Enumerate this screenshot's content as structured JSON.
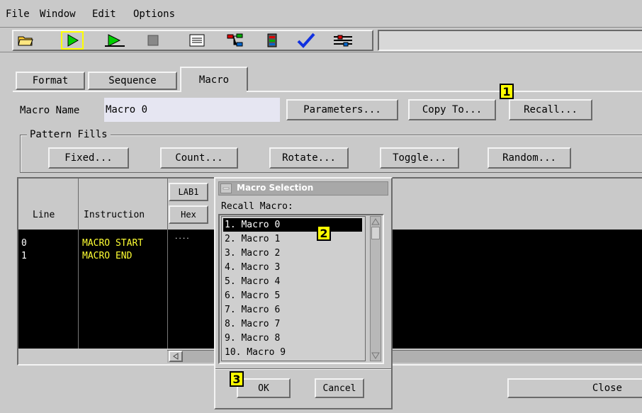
{
  "menubar": {
    "items": [
      "File",
      "Window",
      "Edit",
      "Options"
    ]
  },
  "tabs": {
    "format": "Format",
    "sequence": "Sequence",
    "macro": "Macro"
  },
  "macro_name": {
    "label": "Macro Name",
    "value": "Macro 0"
  },
  "buttons": {
    "parameters": "Parameters...",
    "copy_to": "Copy To...",
    "recall": "Recall...",
    "close": "Close"
  },
  "pattern_fills": {
    "title": "Pattern Fills",
    "fixed": "Fixed...",
    "count": "Count...",
    "rotate": "Rotate...",
    "toggle": "Toggle...",
    "random": "Random..."
  },
  "grid": {
    "headers": {
      "line": "Line",
      "instruction": "Instruction",
      "lab": "LAB1",
      "hex": "Hex"
    },
    "rows": [
      {
        "line": "0",
        "instruction": "MACRO START",
        "value": "...."
      },
      {
        "line": "1",
        "instruction": "MACRO END",
        "value": ""
      }
    ]
  },
  "dialog": {
    "title": "Macro Selection",
    "label": "Recall Macro:",
    "items": [
      "1. Macro 0",
      "2. Macro 1",
      "3. Macro 2",
      "4. Macro 3",
      "5. Macro 4",
      "6. Macro 5",
      "7. Macro 6",
      "8. Macro 7",
      "9. Macro 8",
      "10. Macro 9"
    ],
    "selected_index": 0,
    "ok": "OK",
    "cancel": "Cancel"
  },
  "callouts": [
    "1",
    "2",
    "3"
  ],
  "colors": {
    "yellow_text": "#ffff33",
    "callout": "#ffff00",
    "panel": "#c9c9c9",
    "selection": "#000000"
  }
}
